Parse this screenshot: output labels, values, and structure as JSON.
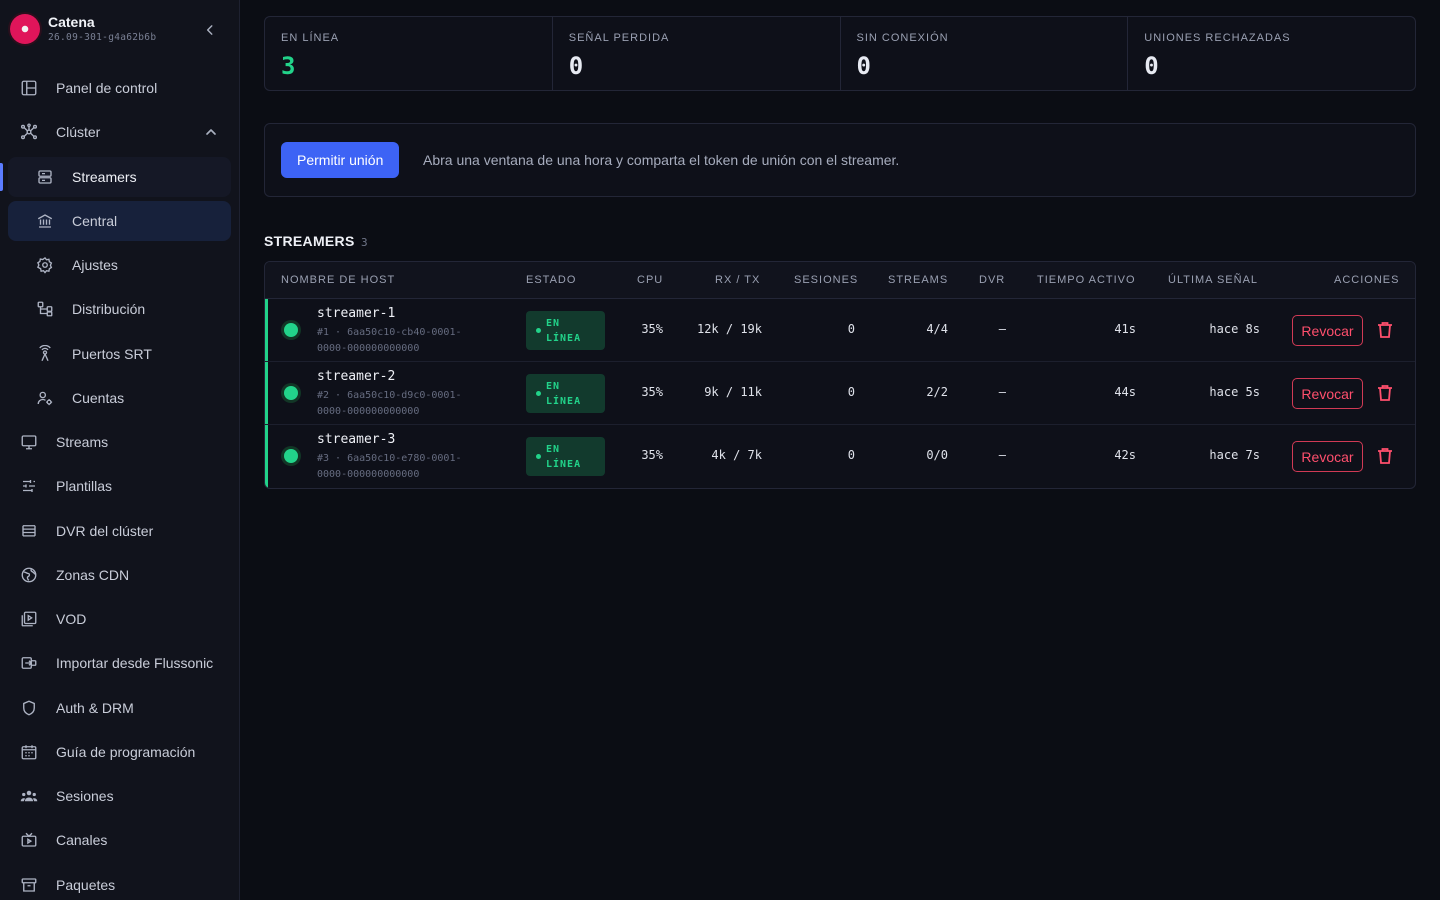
{
  "app": {
    "name": "Catena",
    "version": "26.09-301-g4a62b6b"
  },
  "sidebar": {
    "items": [
      {
        "label": "Panel de control",
        "icon": "layout-icon"
      },
      {
        "label": "Clúster",
        "icon": "cluster-icon",
        "expanded": true
      },
      {
        "label": "Streamers",
        "icon": "server-icon",
        "sub": true,
        "selected": true
      },
      {
        "label": "Central",
        "icon": "bank-icon",
        "sub": true
      },
      {
        "label": "Ajustes",
        "icon": "gear-icon",
        "sub": true
      },
      {
        "label": "Distribución",
        "icon": "distribution-icon",
        "sub": true
      },
      {
        "label": "Puertos SRT",
        "icon": "antenna-icon",
        "sub": true
      },
      {
        "label": "Cuentas",
        "icon": "accounts-icon",
        "sub": true
      },
      {
        "label": "Streams",
        "icon": "monitor-icon"
      },
      {
        "label": "Plantillas",
        "icon": "sliders-icon"
      },
      {
        "label": "DVR del clúster",
        "icon": "storage-icon"
      },
      {
        "label": "Zonas CDN",
        "icon": "globe-icon"
      },
      {
        "label": "VOD",
        "icon": "video-library-icon"
      },
      {
        "label": "Importar desde Flussonic",
        "icon": "import-icon"
      },
      {
        "label": "Auth & DRM",
        "icon": "shield-icon"
      },
      {
        "label": "Guía de programación",
        "icon": "calendar-icon"
      },
      {
        "label": "Sesiones",
        "icon": "users-icon"
      },
      {
        "label": "Canales",
        "icon": "tv-icon"
      },
      {
        "label": "Paquetes",
        "icon": "archive-icon"
      }
    ]
  },
  "stats": [
    {
      "label": "EN LÍNEA",
      "value": "3",
      "color": "#22d38a"
    },
    {
      "label": "SEÑAL PERDIDA",
      "value": "0"
    },
    {
      "label": "SIN CONEXIÓN",
      "value": "0"
    },
    {
      "label": "UNIONES RECHAZADAS",
      "value": "0"
    }
  ],
  "join": {
    "button": "Permitir unión",
    "text": "Abra una ventana de una hora y comparta el token de unión con el streamer."
  },
  "section": {
    "title": "STREAMERS",
    "count": "3"
  },
  "table": {
    "headers": {
      "host": "NOMBRE DE HOST",
      "status": "ESTADO",
      "cpu": "CPU",
      "rxtx": "RX / TX",
      "sessions": "SESIONES",
      "streams": "STREAMS",
      "dvr": "DVR",
      "uptime": "TIEMPO ACTIVO",
      "last": "ÚLTIMA SEÑAL",
      "actions": "ACCIONES"
    },
    "rows": [
      {
        "host": "streamer-1",
        "id": "#1 · 6aa50c10-cb40-0001-0000-000000000000",
        "status": "EN LÍNEA",
        "cpu": "35%",
        "rxtx": "12k / 19k",
        "sessions": "0",
        "streams": "4/4",
        "dvr": "—",
        "uptime": "41s",
        "last": "hace 8s",
        "revoke": "Revocar"
      },
      {
        "host": "streamer-2",
        "id": "#2 · 6aa50c10-d9c0-0001-0000-000000000000",
        "status": "EN LÍNEA",
        "cpu": "35%",
        "rxtx": "9k / 11k",
        "sessions": "0",
        "streams": "2/2",
        "dvr": "—",
        "uptime": "44s",
        "last": "hace 5s",
        "revoke": "Revocar"
      },
      {
        "host": "streamer-3",
        "id": "#3 · 6aa50c10-e780-0001-0000-000000000000",
        "status": "EN LÍNEA",
        "cpu": "35%",
        "rxtx": "4k / 7k",
        "sessions": "0",
        "streams": "0/0",
        "dvr": "—",
        "uptime": "42s",
        "last": "hace 7s",
        "revoke": "Revocar"
      }
    ]
  },
  "colors": {
    "accent": "#3d63f5",
    "online": "#22d38a",
    "danger": "#ff4f6d"
  }
}
